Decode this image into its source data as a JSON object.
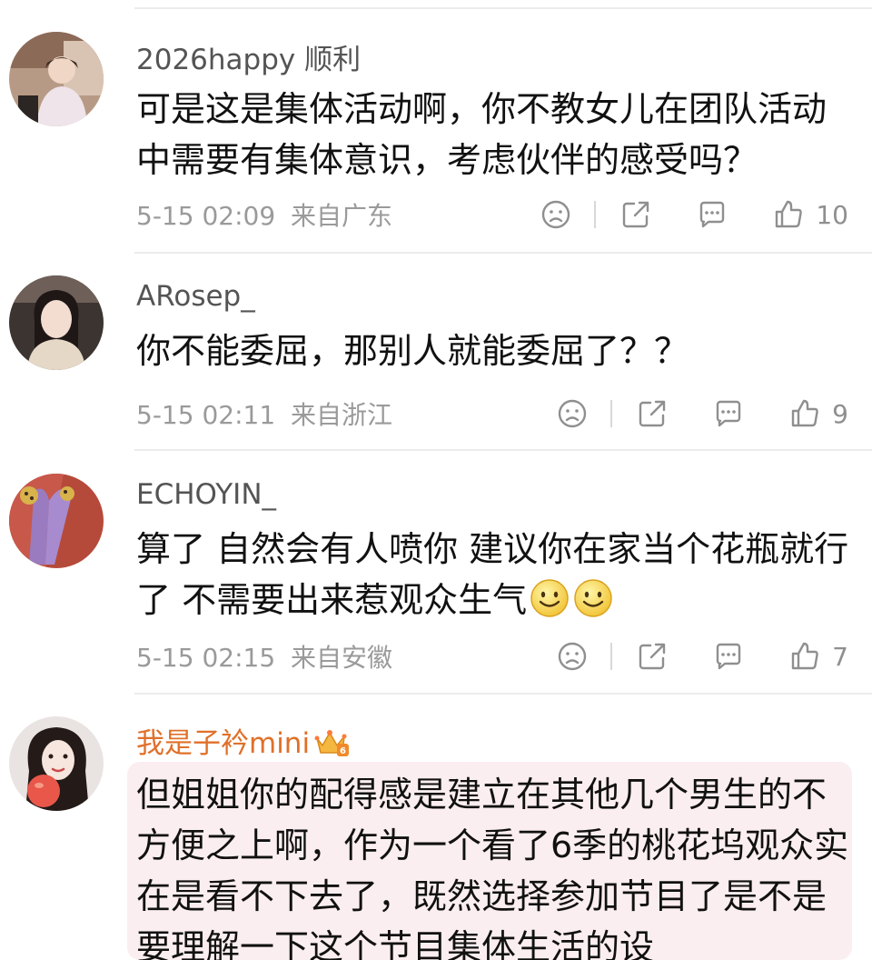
{
  "comments": [
    {
      "username": "2026happy 顺利",
      "content": "可是这是集体活动啊，你不教女儿在团队活动中需要有集体意识，考虑伙伴的感受吗？",
      "time": "5-15 02:09",
      "location": "来自广东",
      "likes": "10"
    },
    {
      "username": "ARosep_",
      "content": "你不能委屈，那别人就能委屈了？？",
      "time": "5-15 02:11",
      "location": "来自浙江",
      "likes": "9"
    },
    {
      "username": "ECHOYIN_",
      "content": "算了 自然会有人喷你 建议你在家当个花瓶就行了 不需要出来惹观众生气",
      "time": "5-15 02:15",
      "location": "来自安徽",
      "likes": "7"
    },
    {
      "username": "我是子衿mini",
      "content": "但姐姐你的配得感是建立在其他几个男生的不方便之上啊，作为一个看了6季的桃花坞观众实在是看不下去了，既然选择参加节目了是不是要理解一下这个节目集体生活的设"
    }
  ],
  "icons": {
    "dislike": "sad-face-icon",
    "repost": "share-icon",
    "reply": "comment-icon",
    "like": "thumb-up-icon",
    "emoji": "smile-emoji-icon",
    "badge": "crown-level-badge-icon"
  },
  "colors": {
    "vip_name": "#e0702a",
    "highlight_bg": "#fbeef0",
    "meta": "#9a9a9a"
  }
}
